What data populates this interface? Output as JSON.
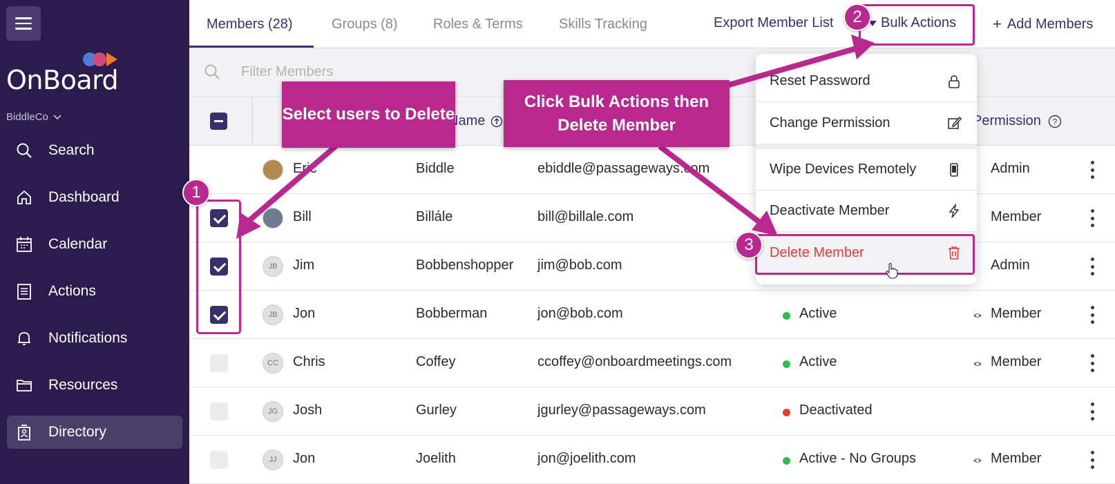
{
  "app": {
    "brand": "OnBoard",
    "org": "BiddleCo"
  },
  "sidebar": {
    "items": [
      {
        "label": "Search",
        "icon": "search-icon"
      },
      {
        "label": "Dashboard",
        "icon": "home-icon"
      },
      {
        "label": "Calendar",
        "icon": "calendar-icon"
      },
      {
        "label": "Actions",
        "icon": "list-icon"
      },
      {
        "label": "Notifications",
        "icon": "bell-icon"
      },
      {
        "label": "Resources",
        "icon": "folder-icon"
      },
      {
        "label": "Directory",
        "icon": "directory-icon"
      }
    ]
  },
  "tabs": [
    {
      "label": "Members (28)"
    },
    {
      "label": "Groups (8)"
    },
    {
      "label": "Roles & Terms"
    },
    {
      "label": "Skills Tracking"
    }
  ],
  "toolbar": {
    "export": "Export Member List",
    "bulk": "Bulk Actions",
    "add": "Add Members"
  },
  "filter": {
    "placeholder": "Filter Members"
  },
  "table": {
    "headers": {
      "last_name": "Name",
      "permission": "Permission"
    },
    "rows": [
      {
        "initials": "",
        "first": "Eric",
        "last": "Biddle",
        "email": "ebiddle@passageways.com",
        "status": "",
        "permission": "Admin",
        "checked": false
      },
      {
        "initials": "",
        "first": "Bill",
        "last": "Billále",
        "email": "bill@billale.com",
        "status": "",
        "permission": "Member",
        "checked": true
      },
      {
        "initials": "JB",
        "first": "Jim",
        "last": "Bobbenshopper",
        "email": "jim@bob.com",
        "status": "",
        "permission": "Admin",
        "checked": true
      },
      {
        "initials": "JB",
        "first": "Jon",
        "last": "Bobberman",
        "email": "jon@bob.com",
        "status": "Active",
        "permission": "Member",
        "checked": true
      },
      {
        "initials": "CC",
        "first": "Chris",
        "last": "Coffey",
        "email": "ccoffey@onboardmeetings.com",
        "status": "Active",
        "permission": "Member",
        "checked": false
      },
      {
        "initials": "JG",
        "first": "Josh",
        "last": "Gurley",
        "email": "jgurley@passageways.com",
        "status": "Deactivated",
        "permission": "",
        "checked": false
      },
      {
        "initials": "JJ",
        "first": "Jon",
        "last": "Joelith",
        "email": "jon@joelith.com",
        "status": "Active - No Groups",
        "permission": "Member",
        "checked": false
      }
    ]
  },
  "menu": {
    "items": [
      {
        "label": "Reset Password",
        "icon": "lock-icon"
      },
      {
        "label": "Change Permission",
        "icon": "edit-icon"
      },
      {
        "label": "Wipe Devices Remotely",
        "icon": "phone-icon"
      },
      {
        "label": "Deactivate Member",
        "icon": "bolt-icon"
      },
      {
        "label": "Delete Member",
        "icon": "trash-icon"
      }
    ]
  },
  "callouts": {
    "select": "Select users to Delete",
    "bulk": "Click Bulk Actions then Delete Member",
    "badge1": "1",
    "badge2": "2",
    "badge3": "3"
  },
  "colors": {
    "accent": "#3b2f6b",
    "sidebar": "#2a1d4e",
    "callout": "#b8288f",
    "active": "#2ebd4f",
    "deactivated": "#f0392b",
    "delete": "#e63a3a"
  }
}
